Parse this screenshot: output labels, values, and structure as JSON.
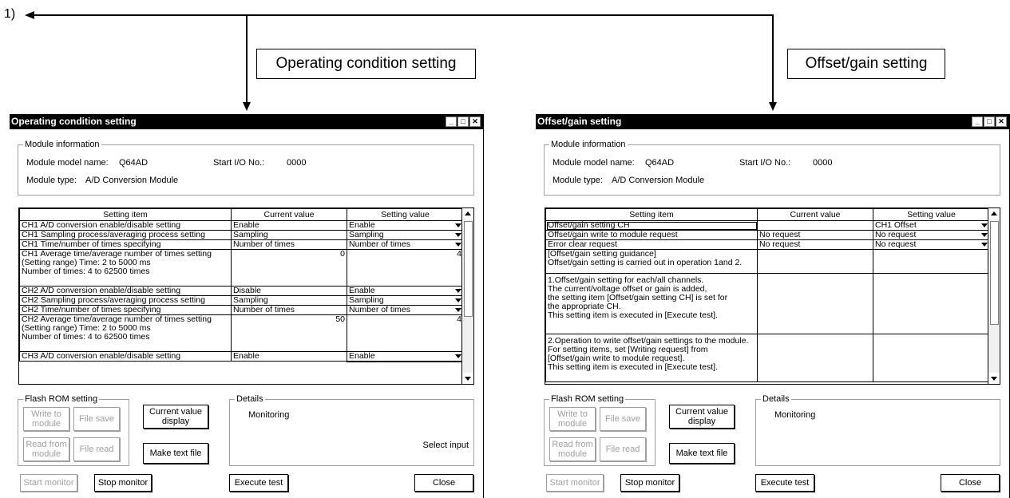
{
  "reference_label": "1)",
  "callouts": {
    "left": "Operating condition setting",
    "right": "Offset/gain setting"
  },
  "left_window": {
    "title": "Operating condition setting",
    "module_info": {
      "group_label": "Module information",
      "model_label": "Module model name:",
      "model_value": "Q64AD",
      "io_label": "Start I/O No.:",
      "io_value": "0000",
      "type_label": "Module type:",
      "type_value": "A/D Conversion Module"
    },
    "columns": [
      "Setting item",
      "Current value",
      "Setting value"
    ],
    "rows": [
      {
        "item": "CH1 A/D conversion enable/disable setting",
        "current": "Enable",
        "setting": "Enable",
        "select": true
      },
      {
        "item": "CH1 Sampling process/averaging process setting",
        "current": "Sampling",
        "setting": "Sampling",
        "select": true
      },
      {
        "item": "CH1 Time/number of times specifying",
        "current": "Number of times",
        "setting": "Number of times",
        "select": true
      },
      {
        "item": "CH1 Average time/average number of times setting\n(Setting range) Time: 2 to 5000 ms\n                     Number of times: 4 to 62500 times",
        "current": "0",
        "setting": "4",
        "select": false
      },
      {
        "item": "CH2 A/D conversion enable/disable setting",
        "current": "Disable",
        "setting": "Enable",
        "select": true
      },
      {
        "item": "CH2 Sampling process/averaging process setting",
        "current": "Sampling",
        "setting": "Sampling",
        "select": true
      },
      {
        "item": "CH2 Time/number of times specifying",
        "current": "Number of times",
        "setting": "Number of times",
        "select": true
      },
      {
        "item": "CH2 Average time/average number of times setting\n(Setting range) Time: 2 to 5000 ms\n                     Number of times: 4 to 62500 times",
        "current": "50",
        "setting": "4",
        "select": false
      },
      {
        "item": "CH3 A/D conversion enable/disable setting",
        "current": "Enable",
        "setting": "Enable",
        "select": true
      }
    ],
    "flash_rom": {
      "group_label": "Flash ROM setting",
      "write_to_module": "Write to\nmodule",
      "file_save": "File save",
      "read_from_module": "Read from\nmodule",
      "file_read": "File read"
    },
    "current_value_display": "Current value\ndisplay",
    "make_text_file": "Make text file",
    "details": {
      "group_label": "Details",
      "status": "Monitoring",
      "hint": "Select input"
    },
    "start_monitor": "Start monitor",
    "stop_monitor": "Stop monitor",
    "execute_test": "Execute test",
    "close": "Close"
  },
  "right_window": {
    "title": "Offset/gain setting",
    "module_info": {
      "group_label": "Module information",
      "model_label": "Module model name:",
      "model_value": "Q64AD",
      "io_label": "Start I/O No.:",
      "io_value": "0000",
      "type_label": "Module type:",
      "type_value": "A/D Conversion Module"
    },
    "columns": [
      "Setting item",
      "Current value",
      "Setting value"
    ],
    "rows": [
      {
        "item": "Offset/gain setting CH",
        "current": "",
        "setting": "CH1 Offset",
        "select": true
      },
      {
        "item": "Offset/gain write to module request",
        "current": "No request",
        "setting": "No request",
        "select": true
      },
      {
        "item": "Error clear request",
        "current": "No request",
        "setting": "No request",
        "select": true
      },
      {
        "item": "[Offset/gain setting guidance]\nOffset/gain setting is carried out in operation 1and 2.",
        "current": "",
        "setting": "",
        "select": false
      },
      {
        "item": "1.Offset/gain setting for each/all channels.\n   The current/voltage offset or gain is added,\n   the setting item [Offset/gain setting CH] is set for\n   the appropriate CH.\n   This setting item is executed in [Execute test].",
        "current": "",
        "setting": "",
        "select": false
      },
      {
        "item": "2.Operation to write offset/gain settings to the module.\n   For setting items, set [Writing request] from\n   [Offset/gain write to module request].\n   This setting item is executed in [Execute test].",
        "current": "",
        "setting": "",
        "select": false
      }
    ],
    "flash_rom": {
      "group_label": "Flash ROM setting",
      "write_to_module": "Write to\nmodule",
      "file_save": "File save",
      "read_from_module": "Read from\nmodule",
      "file_read": "File read"
    },
    "current_value_display": "Current value\ndisplay",
    "make_text_file": "Make text file",
    "details": {
      "group_label": "Details",
      "status": "Monitoring"
    },
    "start_monitor": "Start monitor",
    "stop_monitor": "Stop monitor",
    "execute_test": "Execute test",
    "close": "Close"
  }
}
